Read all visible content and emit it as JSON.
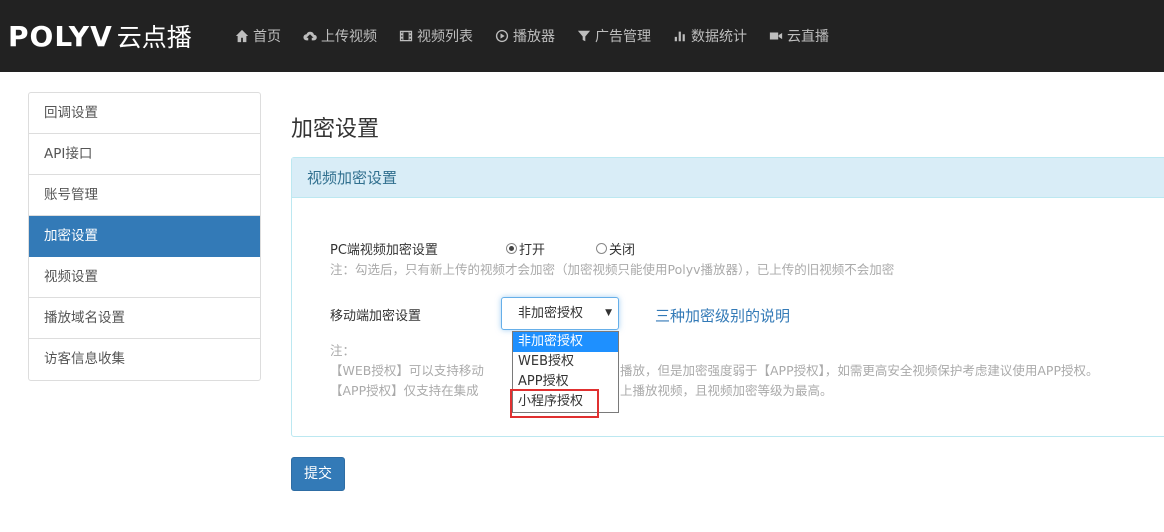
{
  "brand": {
    "latin": "POLYV",
    "cn": "云点播"
  },
  "nav": {
    "items": [
      {
        "label": "首页",
        "icon": "home-icon"
      },
      {
        "label": "上传视频",
        "icon": "cloud-upload-icon"
      },
      {
        "label": "视频列表",
        "icon": "film-icon"
      },
      {
        "label": "播放器",
        "icon": "play-circle-icon"
      },
      {
        "label": "广告管理",
        "icon": "filter-icon"
      },
      {
        "label": "数据统计",
        "icon": "bar-chart-icon"
      },
      {
        "label": "云直播",
        "icon": "video-camera-icon"
      }
    ]
  },
  "sidebar": {
    "items": [
      {
        "label": "回调设置",
        "active": false
      },
      {
        "label": "API接口",
        "active": false
      },
      {
        "label": "账号管理",
        "active": false
      },
      {
        "label": "加密设置",
        "active": true
      },
      {
        "label": "视频设置",
        "active": false
      },
      {
        "label": "播放域名设置",
        "active": false
      },
      {
        "label": "访客信息收集",
        "active": false
      }
    ]
  },
  "main": {
    "page_title": "加密设置",
    "panel_title": "视频加密设置",
    "pc": {
      "label": "PC端视频加密设置",
      "radio_on": "打开",
      "radio_off": "关闭",
      "selected": "on",
      "note": "注：勾选后，只有新上传的视频才会加密（加密视频只能使用Polyv播放器），已上传的旧视频不会加密"
    },
    "mobile": {
      "label": "移动端加密设置",
      "selected_value": "非加密授权",
      "options": [
        "非加密授权",
        "WEB授权",
        "APP授权",
        "小程序授权"
      ],
      "highlighted_option": "非加密授权",
      "levels_link": "三种加密级别的说明",
      "note_prefix": "注：",
      "note_line1_a": "【WEB授权】可以支持移动",
      "note_line1_b": "播放，但是加密强度弱于【APP授权】，如需更高安全视频保护考虑建议使用APP授权。",
      "note_line2_a": "【APP授权】仅支持在集成",
      "note_line2_b": "上播放视频，且视频加密等级为最高。"
    },
    "submit_label": "提交"
  },
  "colors": {
    "navbar_bg": "#222222",
    "primary": "#337ab7",
    "panel_heading_bg": "#d9edf7",
    "option_highlight": "#1e90ff",
    "annotation_red": "#e03030"
  }
}
